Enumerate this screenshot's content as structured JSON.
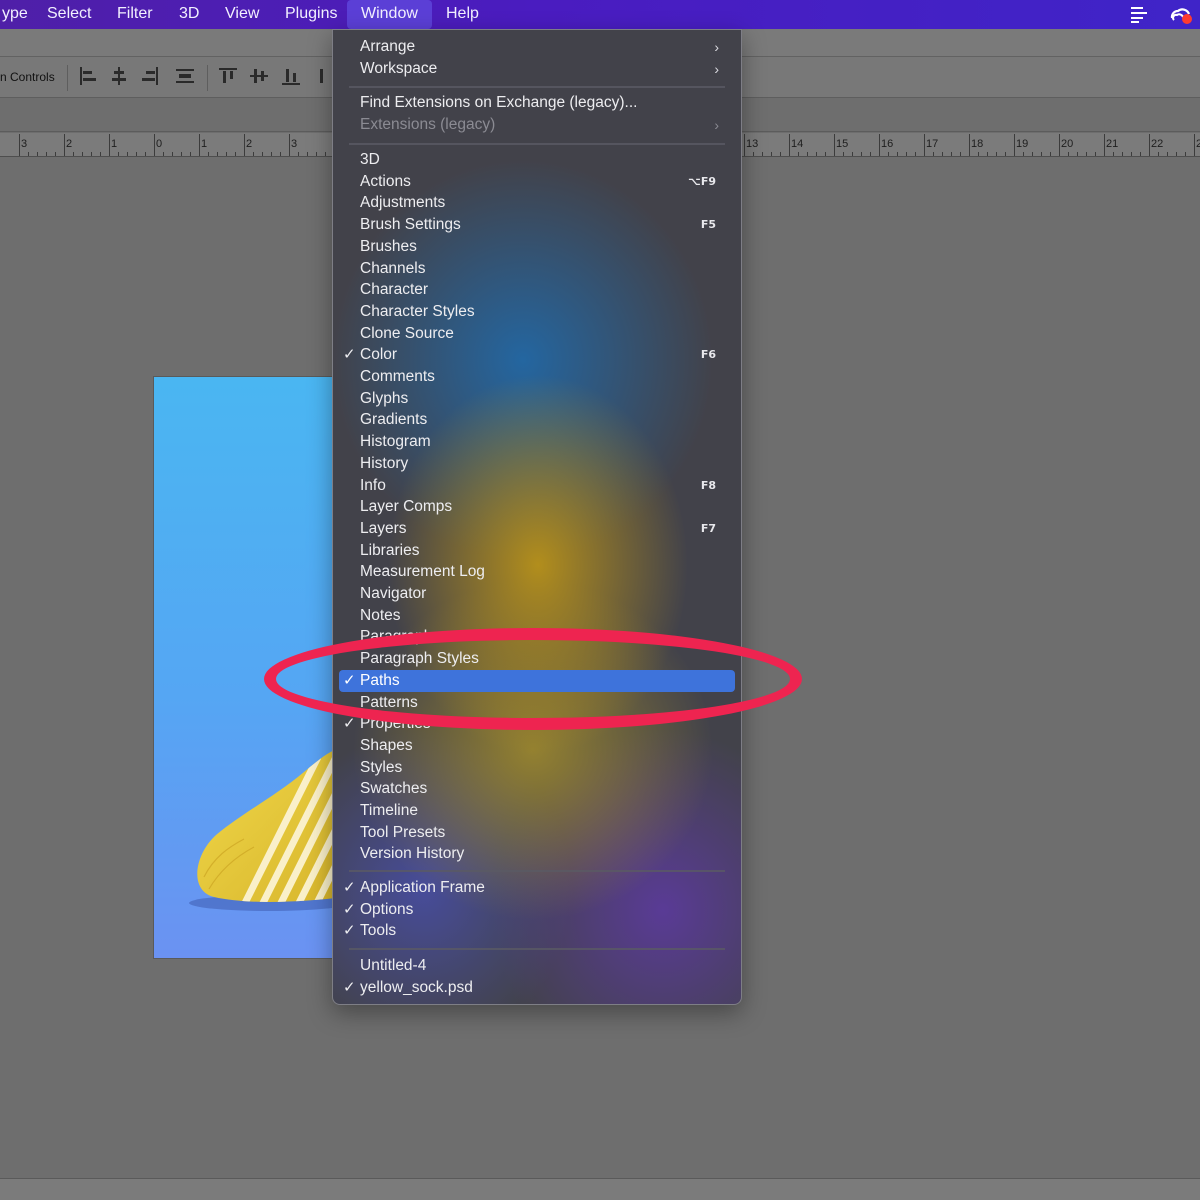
{
  "menubar": {
    "items": [
      "ype",
      "Select",
      "Filter",
      "3D",
      "View",
      "Plugins",
      "Window",
      "Help"
    ],
    "active": "Window",
    "tray_icons": [
      "list-icon",
      "creative-cloud-icon"
    ]
  },
  "controls": {
    "label": "n Controls"
  },
  "ruler": {
    "labels": [
      "3",
      "2",
      "1",
      "0",
      "1",
      "2",
      "3",
      "13",
      "14",
      "15",
      "16",
      "17",
      "18",
      "19",
      "20",
      "21",
      "22",
      "2"
    ]
  },
  "menu": {
    "section1": [
      {
        "label": "Arrange",
        "submenu": true
      },
      {
        "label": "Workspace",
        "submenu": true
      }
    ],
    "section2": [
      {
        "label": "Find Extensions on Exchange (legacy)..."
      },
      {
        "label": "Extensions (legacy)",
        "submenu": true,
        "disabled": true
      }
    ],
    "panels": [
      {
        "label": "3D"
      },
      {
        "label": "Actions",
        "shortcut": "⌥F9"
      },
      {
        "label": "Adjustments"
      },
      {
        "label": "Brush Settings",
        "shortcut": "F5"
      },
      {
        "label": "Brushes"
      },
      {
        "label": "Channels"
      },
      {
        "label": "Character"
      },
      {
        "label": "Character Styles"
      },
      {
        "label": "Clone Source"
      },
      {
        "label": "Color",
        "checked": true,
        "shortcut": "F6"
      },
      {
        "label": "Comments"
      },
      {
        "label": "Glyphs"
      },
      {
        "label": "Gradients"
      },
      {
        "label": "Histogram"
      },
      {
        "label": "History"
      },
      {
        "label": "Info",
        "shortcut": "F8"
      },
      {
        "label": "Layer Comps"
      },
      {
        "label": "Layers",
        "shortcut": "F7"
      },
      {
        "label": "Libraries"
      },
      {
        "label": "Measurement Log"
      },
      {
        "label": "Navigator"
      },
      {
        "label": "Notes"
      },
      {
        "label": "Paragraph"
      },
      {
        "label": "Paragraph Styles"
      },
      {
        "label": "Paths",
        "checked": true,
        "highlighted": true
      },
      {
        "label": "Patterns"
      },
      {
        "label": "Properties",
        "checked": true
      },
      {
        "label": "Shapes"
      },
      {
        "label": "Styles"
      },
      {
        "label": "Swatches"
      },
      {
        "label": "Timeline"
      },
      {
        "label": "Tool Presets"
      },
      {
        "label": "Version History"
      }
    ],
    "app": [
      {
        "label": "Application Frame",
        "checked": true
      },
      {
        "label": "Options",
        "checked": true
      },
      {
        "label": "Tools",
        "checked": true
      }
    ],
    "docs": [
      {
        "label": "Untitled-4"
      },
      {
        "label": "yellow_sock.psd",
        "checked": true
      }
    ],
    "check_glyph": "✓",
    "chevron_glyph": "›"
  },
  "colors": {
    "menubar": "#4a1cc0",
    "highlight": "#3e73db",
    "annotation": "#ee2450",
    "canvas_bg": "#6e6e6e"
  }
}
